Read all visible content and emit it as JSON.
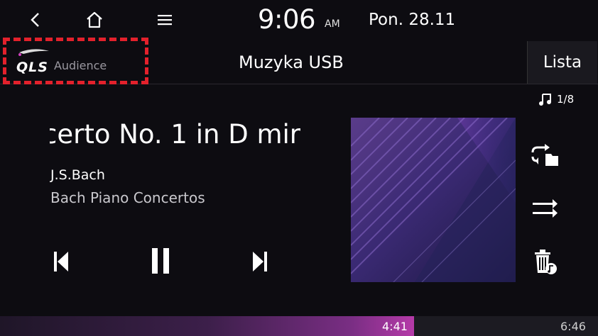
{
  "status_bar": {
    "time": "9:06",
    "ampm": "AM",
    "date": "Pon. 28.11"
  },
  "nav": {
    "back_icon": "back-arrow-icon",
    "home_icon": "home-icon",
    "menu_icon": "menu-icon"
  },
  "brand": {
    "logo_text": "QLS",
    "audience_label": "Audience"
  },
  "header": {
    "title": "Muzyka USB",
    "list_button": "Lista"
  },
  "track": {
    "position": "1/8",
    "title": "certo No. 1 in D mir",
    "artist": "J.S.Bach",
    "album": "Bach Piano Concertos"
  },
  "playback": {
    "elapsed": "4:41",
    "total": "6:46",
    "progress": 0.6925
  },
  "colors": {
    "highlight_dashed": "#e3212c",
    "progress_accent": "#b53aa8",
    "background": "#0d0c11"
  }
}
